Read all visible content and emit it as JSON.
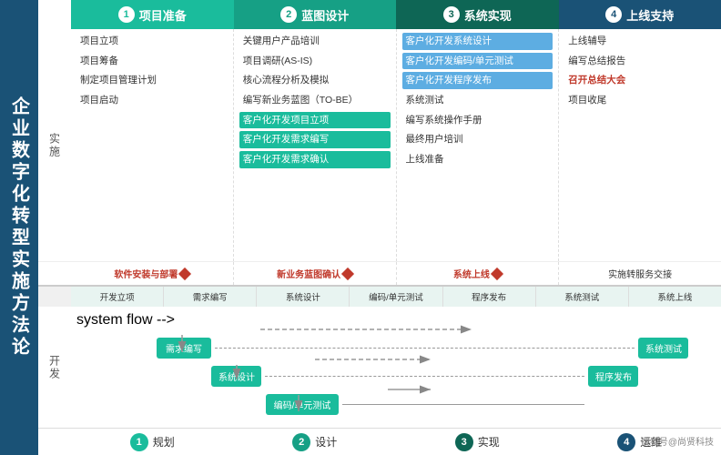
{
  "title": "企业数字化转型实施方法论",
  "left_title": "企业数字化转型实施方法论",
  "phases": [
    {
      "num": "1",
      "label": "项目准备",
      "color": "#1abc9c"
    },
    {
      "num": "2",
      "label": "蓝图设计",
      "color": "#16a085"
    },
    {
      "num": "3",
      "label": "系统实现",
      "color": "#0e6655"
    },
    {
      "num": "4",
      "label": "上线支持",
      "color": "#1a5276"
    }
  ],
  "row_label_impl": "实施",
  "row_label_dev": "开发",
  "impl_tasks": {
    "phase1": [
      "项目立项",
      "项目筹备",
      "制定项目管理计划",
      "项目启动"
    ],
    "phase2": [
      "关键用户产品培训",
      "项目调研(AS-IS)",
      "核心流程分析及模拟",
      "编写新业务蓝图（TO-BE）",
      "客户化开发项目立项",
      "客户化开发需求编写",
      "客户化开发需求确认"
    ],
    "phase3": [
      "客户化开发系统设计",
      "客户化开发编码/单元测试",
      "客户化开发程序发布",
      "系统测试",
      "编写系统操作手册",
      "最终用户培训",
      "上线准备"
    ],
    "phase4": [
      "上线辅导",
      "编写总结报告",
      "召开总结大会",
      "项目收尾"
    ]
  },
  "milestones": {
    "phase1": "软件安装与部署",
    "phase2": "新业务蓝图确认",
    "phase3": "系统上线",
    "phase4": "实施转服务交接"
  },
  "dev_phases": [
    "开发立项",
    "需求编写",
    "系统设计",
    "编码/单元测试",
    "程序发布",
    "系统测试",
    "系统上线"
  ],
  "dev_flows": [
    {
      "label": "需求编写",
      "arrow": "dashed-long",
      "end": "系统测试"
    },
    {
      "label": "系统设计",
      "arrow": "dashed-medium",
      "end": "程序发布"
    },
    {
      "label": "编码/单元测试",
      "arrow": "short"
    }
  ],
  "footer_phases": [
    {
      "num": "1",
      "label": "规划"
    },
    {
      "num": "2",
      "label": "设计"
    },
    {
      "num": "3",
      "label": "实现"
    },
    {
      "num": "4",
      "label": "运维"
    }
  ],
  "watermark": "搜狐号@尚贤科技"
}
